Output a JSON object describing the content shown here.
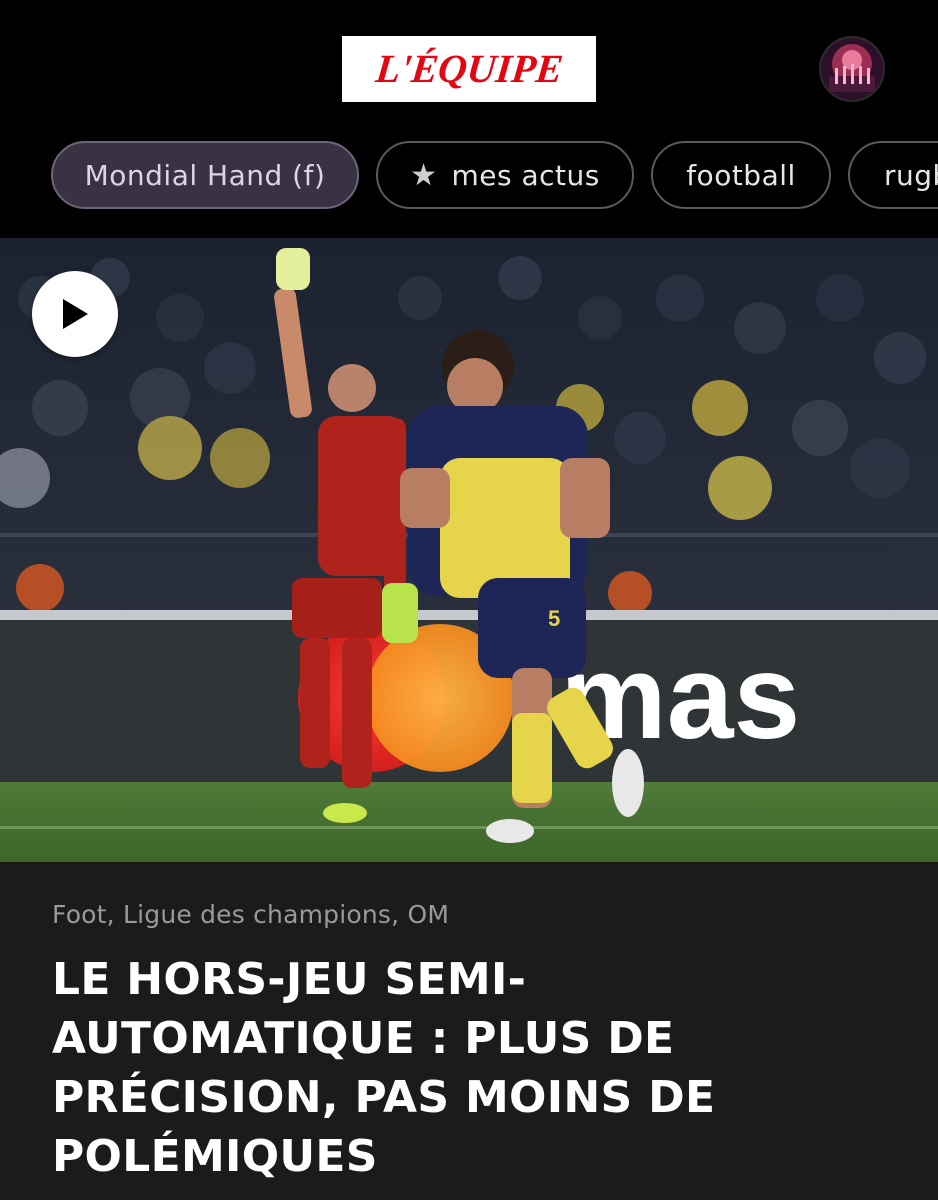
{
  "header": {
    "logo_text": "L'ÉQUIPE",
    "logo_color": "#e30613",
    "avatar_icon": "profile-avatar"
  },
  "tabs": [
    {
      "label": "Mondial Hand (f)",
      "active": true
    },
    {
      "label": "mes actus",
      "icon": "star-icon"
    },
    {
      "label": "football"
    },
    {
      "label": "rugby"
    }
  ],
  "hero": {
    "play_icon": "play-icon",
    "background_text": "mas"
  },
  "article": {
    "category": "Foot, Ligue des champions, OM",
    "headline_lines": [
      "LE HORS-JEU SEMI-",
      "AUTOMATIQUE : PLUS DE",
      "PRÉCISION, PAS MOINS DE",
      "POLÉMIQUES"
    ]
  }
}
